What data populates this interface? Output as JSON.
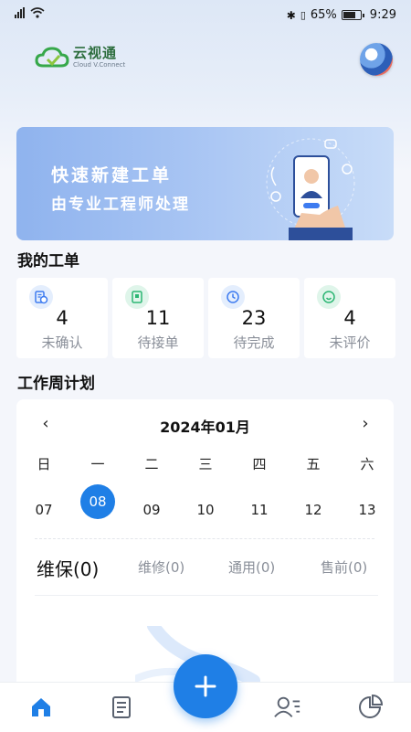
{
  "status_bar": {
    "battery": "65%",
    "time": "9:29"
  },
  "header": {
    "logo_title": "云视通",
    "logo_subtitle": "Cloud V.Connect"
  },
  "banner": {
    "title": "快速新建工单",
    "subtitle": "由专业工程师处理"
  },
  "my_orders": {
    "title": "我的工单",
    "stats": [
      {
        "value": "4",
        "label": "未确认",
        "icon": "document-clock-icon",
        "color": "#3d7bf0"
      },
      {
        "value": "11",
        "label": "待接单",
        "icon": "clipboard-icon",
        "color": "#2bb673"
      },
      {
        "value": "23",
        "label": "待完成",
        "icon": "clock-icon",
        "color": "#3d7bf0"
      },
      {
        "value": "4",
        "label": "未评价",
        "icon": "rating-icon",
        "color": "#2bb673"
      }
    ]
  },
  "weekly_plan": {
    "title": "工作周计划",
    "month": "2024年01月",
    "weekdays": [
      "日",
      "一",
      "二",
      "三",
      "四",
      "五",
      "六"
    ],
    "days": [
      "07",
      "08",
      "09",
      "10",
      "11",
      "12",
      "13"
    ],
    "selected_day": "08",
    "tabs": [
      "维保(0)",
      "维修(0)",
      "通用(0)",
      "售前(0)"
    ],
    "active_tab": "维保(0)"
  },
  "bottom_nav": {
    "items": [
      "home-icon",
      "orders-icon",
      "contacts-icon",
      "statistics-icon"
    ],
    "active": "home-icon"
  },
  "colors": {
    "accent": "#1f7fe6",
    "green": "#2bb673"
  }
}
